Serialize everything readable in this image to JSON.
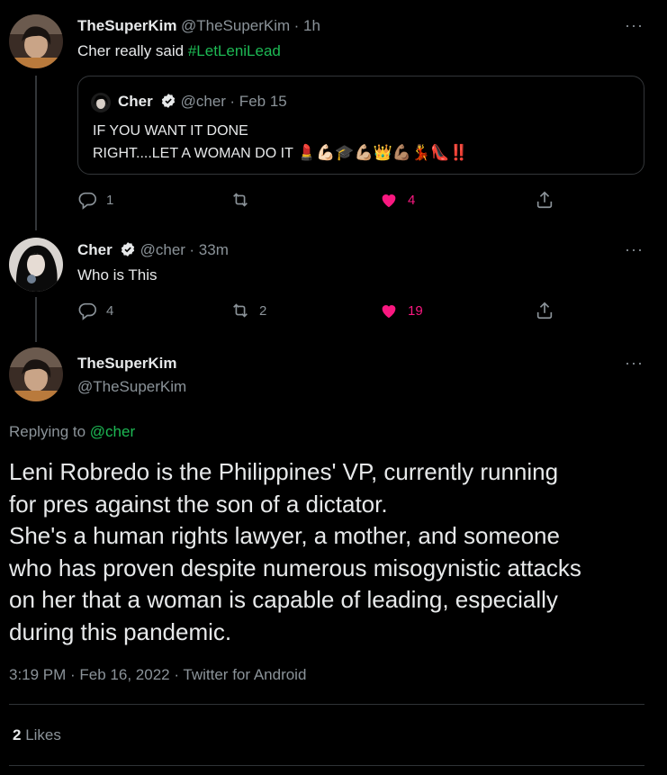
{
  "tweet1": {
    "display_name": "TheSuperKim",
    "handle": "@TheSuperKim",
    "time": "· 1h",
    "text_prefix": "Cher really said ",
    "hashtag": "#LetLeniLead",
    "quote": {
      "display_name": "Cher",
      "handle": "@cher",
      "time": "· Feb 15",
      "line1": "IF YOU WANT IT DONE",
      "line2": "RIGHT....LET A WOMAN DO IT",
      "emojis": "💄💪🏻🎓💪🏼👑💪🏽💃👠‼️"
    },
    "replies": "1",
    "retweets": "",
    "likes": "4"
  },
  "tweet2": {
    "display_name": "Cher",
    "handle": "@cher",
    "time": "· 33m",
    "text": "Who is This",
    "replies": "4",
    "retweets": "2",
    "likes": "19"
  },
  "main": {
    "display_name": "TheSuperKim",
    "handle": "@TheSuperKim",
    "replying_prefix": "Replying to ",
    "replying_to": "@cher",
    "text_lines": [
      "Leni Robredo is the Philippines' VP, currently running",
      "for pres against the son of a dictator.",
      "She's a human rights lawyer, a mother, and someone",
      "who has proven despite numerous misogynistic attacks",
      "on her that a woman is capable of leading, especially",
      "during this pandemic."
    ],
    "timestamp": "3:19 PM · Feb 16, 2022 · Twitter for Android",
    "likes_count": "2",
    "likes_label": "Likes"
  },
  "more_icon": "···",
  "colors": {
    "background": "#000000",
    "text": "#e7e9ea",
    "muted": "#8b9399",
    "accent_link": "#1db954",
    "like": "#f91880",
    "border": "#333639"
  },
  "icons": [
    "reply-icon",
    "retweet-icon",
    "like-icon",
    "share-icon",
    "verified-icon",
    "more-icon"
  ]
}
